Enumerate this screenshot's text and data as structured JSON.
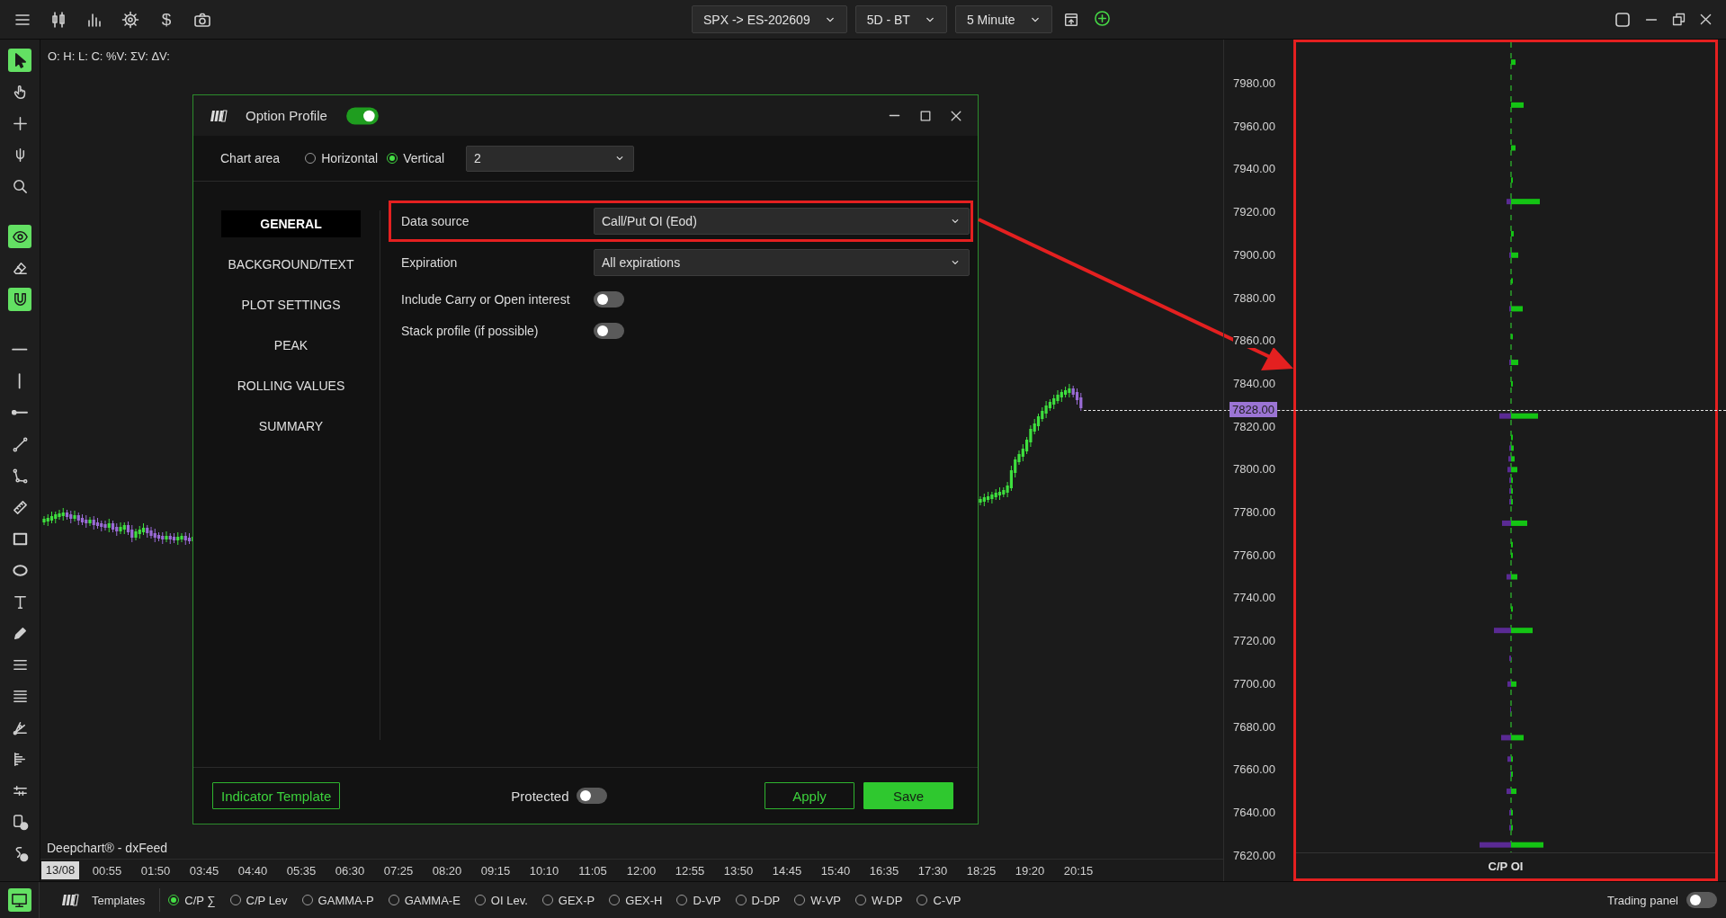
{
  "top_bar": {
    "currency_symbol": "$",
    "selectors": [
      {
        "label": "SPX -> ES-202609"
      },
      {
        "label": "5D - BT"
      },
      {
        "label": "5 Minute"
      }
    ]
  },
  "left_toolbar": {
    "tools": [
      {
        "active": true
      },
      {
        "active": false
      },
      {
        "active": false
      },
      {
        "active": false
      },
      {
        "active": false
      },
      {
        "active": true
      },
      {
        "active": false
      },
      {
        "active": true
      },
      {
        "active": false
      },
      {
        "active": false
      },
      {
        "active": false
      },
      {
        "active": false
      },
      {
        "active": false
      },
      {
        "active": false
      },
      {
        "active": false
      },
      {
        "active": false
      },
      {
        "active": false
      },
      {
        "active": false
      },
      {
        "active": false
      },
      {
        "active": false
      },
      {
        "active": false
      },
      {
        "active": false
      },
      {
        "active": false
      },
      {
        "active": false
      },
      {
        "active": false
      }
    ]
  },
  "chart": {
    "ohlc_legend": "O: H: L: C: %V: ΣV: ΔV:",
    "source": "Deepchart® - dxFeed",
    "time_axis": [
      {
        "label": "13/08",
        "highlighted": true
      },
      {
        "label": "00:55",
        "highlighted": false
      },
      {
        "label": "01:50",
        "highlighted": false
      },
      {
        "label": "03:45",
        "highlighted": false
      },
      {
        "label": "04:40",
        "highlighted": false
      },
      {
        "label": "05:35",
        "highlighted": false
      },
      {
        "label": "06:30",
        "highlighted": false
      },
      {
        "label": "07:25",
        "highlighted": false
      },
      {
        "label": "08:20",
        "highlighted": false
      },
      {
        "label": "09:15",
        "highlighted": false
      },
      {
        "label": "10:10",
        "highlighted": false
      },
      {
        "label": "11:05",
        "highlighted": false
      },
      {
        "label": "12:00",
        "highlighted": false
      },
      {
        "label": "12:55",
        "highlighted": false
      },
      {
        "label": "13:50",
        "highlighted": false
      },
      {
        "label": "14:45",
        "highlighted": false
      },
      {
        "label": "15:40",
        "highlighted": false
      },
      {
        "label": "16:35",
        "highlighted": false
      },
      {
        "label": "17:30",
        "highlighted": false
      },
      {
        "label": "18:25",
        "highlighted": false
      },
      {
        "label": "19:20",
        "highlighted": false
      },
      {
        "label": "20:15",
        "highlighted": false
      }
    ]
  },
  "price_axis": {
    "labels": [
      "7980.00",
      "7960.00",
      "7940.00",
      "7920.00",
      "7900.00",
      "7880.00",
      "7860.00",
      "7840.00",
      "7820.00",
      "7800.00",
      "7780.00",
      "7760.00",
      "7740.00",
      "7720.00",
      "7700.00",
      "7680.00",
      "7660.00",
      "7640.00",
      "7620.00"
    ],
    "current_price": "7828.00"
  },
  "profile_panel": {
    "title": "C/P OI",
    "highlighted": true
  },
  "dialog": {
    "title": "Option Profile",
    "enabled": true,
    "chart_area": {
      "label": "Chart area",
      "options": [
        {
          "label": "Horizontal",
          "selected": false
        },
        {
          "label": "Vertical",
          "selected": true
        }
      ],
      "value": "2"
    },
    "nav": [
      {
        "label": "GENERAL",
        "selected": true
      },
      {
        "label": "BACKGROUND/TEXT",
        "selected": false
      },
      {
        "label": "PLOT SETTINGS",
        "selected": false
      },
      {
        "label": "PEAK",
        "selected": false
      },
      {
        "label": "ROLLING VALUES",
        "selected": false
      },
      {
        "label": "SUMMARY",
        "selected": false
      }
    ],
    "fields": [
      {
        "kind": "dropdown",
        "label": "Data source",
        "value": "Call/Put OI (Eod)",
        "highlighted": true
      },
      {
        "kind": "dropdown",
        "label": "Expiration",
        "value": "All expirations",
        "highlighted": false
      },
      {
        "kind": "toggle",
        "label": "Include Carry or Open interest",
        "on": false,
        "highlighted": false
      },
      {
        "kind": "toggle",
        "label": "Stack profile (if possible)",
        "on": false,
        "highlighted": false
      }
    ],
    "footer": {
      "template_button": "Indicator Template",
      "protected": {
        "label": "Protected",
        "on": false
      },
      "buttons": [
        {
          "label": "Apply",
          "kind": "secondary"
        },
        {
          "label": "Save",
          "kind": "primary"
        }
      ]
    }
  },
  "bottom_bar": {
    "panel_button": {
      "active": true
    },
    "templates_label": "Templates",
    "templates": [
      {
        "label": "C/P ∑",
        "selected": true
      },
      {
        "label": "C/P Lev",
        "selected": false
      },
      {
        "label": "GAMMA-P",
        "selected": false
      },
      {
        "label": "GAMMA-E",
        "selected": false
      },
      {
        "label": "OI Lev.",
        "selected": false
      },
      {
        "label": "GEX-P",
        "selected": false
      },
      {
        "label": "GEX-H",
        "selected": false
      },
      {
        "label": "D-VP",
        "selected": false
      },
      {
        "label": "D-DP",
        "selected": false
      },
      {
        "label": "W-VP",
        "selected": false
      },
      {
        "label": "W-DP",
        "selected": false
      },
      {
        "label": "C-VP",
        "selected": false
      }
    ],
    "trading_panel": {
      "label": "Trading panel",
      "on": false
    }
  }
}
